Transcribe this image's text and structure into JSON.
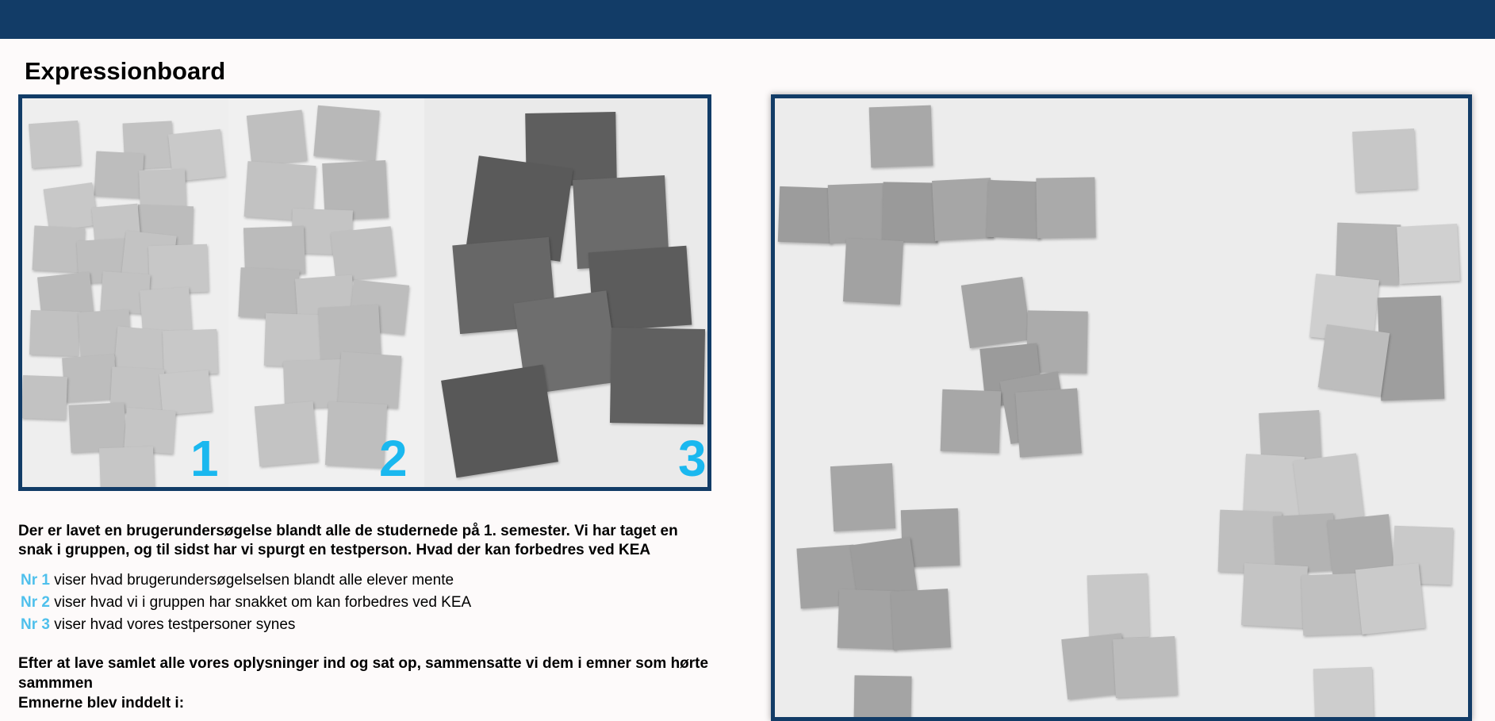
{
  "header": {
    "color": "#123c67"
  },
  "page_title": "Expressionboard",
  "left_photo": {
    "panels": [
      {
        "number": "1"
      },
      {
        "number": "2"
      },
      {
        "number": "3"
      }
    ],
    "number_color": "#1ab8ef"
  },
  "text": {
    "intro": "Der er lavet en brugerundersøgelse blandt alle de studernede på 1. semester. Vi har taget en snak i gruppen, og til sidst har vi spurgt en testperson. Hvad der kan forbedres ved KEA",
    "items": [
      {
        "label": "Nr 1",
        "text": "viser hvad brugerundersøgelselsen blandt alle elever mente"
      },
      {
        "label": "Nr 2",
        "text": "viser hvad vi i gruppen har snakket om kan forbedres ved KEA"
      },
      {
        "label": "Nr 3",
        "text": "viser hvad vores testpersoner synes"
      }
    ],
    "after_line1": "Efter at lave samlet alle vores oplysninger ind og sat op, sammensatte vi dem i emner som hørte sammmen",
    "after_line2": "Emnerne blev inddelt i:"
  }
}
